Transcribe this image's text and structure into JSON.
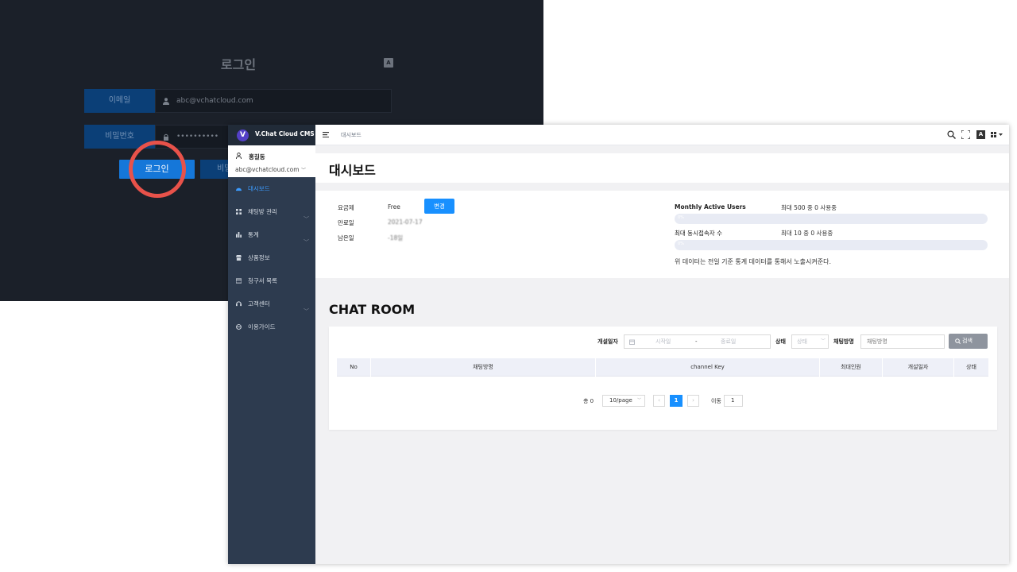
{
  "login": {
    "title": "로그인",
    "lang_icon": "A",
    "email_label": "이메일",
    "email_value": "abc@vchatcloud.com",
    "password_label": "비밀번호",
    "password_value": "••••••••••",
    "login_button": "로그인",
    "second_button": "비밀"
  },
  "app": {
    "brand": "V.Chat Cloud CMS",
    "logo_letter": "V",
    "user_name": "홍길동",
    "user_email": "abc@vchatcloud.com"
  },
  "sidebar": {
    "items": [
      {
        "label": "대시보드",
        "icon": "dashboard-icon",
        "active": true
      },
      {
        "label": "채팅방 관리",
        "icon": "grid-icon",
        "chevron": true
      },
      {
        "label": "통계",
        "icon": "bar-chart-icon",
        "chevron": true
      },
      {
        "label": "상품정보",
        "icon": "shop-icon"
      },
      {
        "label": "청구서 목록",
        "icon": "card-icon"
      },
      {
        "label": "고객센터",
        "icon": "headset-icon",
        "chevron": true
      },
      {
        "label": "이용가이드",
        "icon": "guide-icon"
      }
    ]
  },
  "topbar": {
    "breadcrumb": "대시보드",
    "icons": [
      "search-icon",
      "fullscreen-icon",
      "translate-icon",
      "apps-icon"
    ]
  },
  "dashboard": {
    "title": "대시보드",
    "plan_label": "요금제",
    "plan_value": "Free",
    "change_button": "변경",
    "expire_label": "만료일",
    "expire_value": "2021-07-17",
    "remaining_label": "남은일",
    "remaining_value": "-18일",
    "mau_label": "Monthly Active Users",
    "mau_value": "최대 500 중 0 사용중",
    "mau_percent": "0%",
    "mau_fraction": 0,
    "concurrent_label": "최대 동시접속자 수",
    "concurrent_value": "최대 10 중 0 사용중",
    "concurrent_percent": "0%",
    "concurrent_fraction": 0,
    "note": "위 데이터는 전일 기준 통계 데이터를 통해서 노출시켜준다."
  },
  "chat_room": {
    "title": "CHAT ROOM",
    "filters": {
      "date_label": "개설일자",
      "start_placeholder": "시작일",
      "range_sep": "-",
      "end_placeholder": "종료일",
      "status_label": "상태",
      "status_placeholder": "상태",
      "name_label": "채팅방명",
      "name_placeholder": "채팅방명",
      "search_button": "검색"
    },
    "columns": [
      "No",
      "채팅방명",
      "channel Key",
      "최대인원",
      "개설일자",
      "상태"
    ],
    "rows": [],
    "pagination": {
      "total": "총 0",
      "page_size": "10/page",
      "current_page": "1",
      "goto_label": "이동",
      "goto_value": "1"
    }
  }
}
